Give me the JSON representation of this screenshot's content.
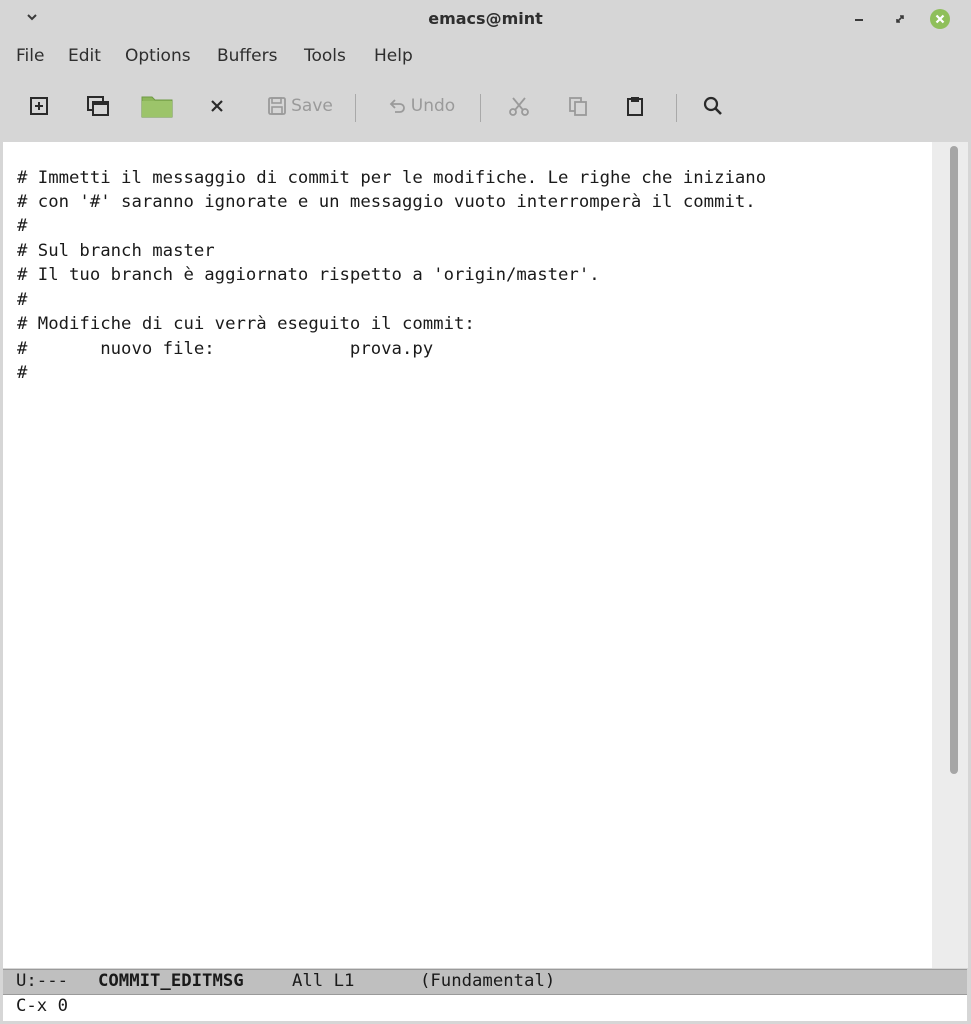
{
  "window": {
    "title": "emacs@mint"
  },
  "menubar": {
    "items": [
      "File",
      "Edit",
      "Options",
      "Buffers",
      "Tools",
      "Help"
    ]
  },
  "toolbar": {
    "save_label": "Save",
    "undo_label": "Undo",
    "icons": [
      "new-file-icon",
      "new-frame-icon",
      "open-folder-icon",
      "close-icon",
      "save-icon",
      "undo-icon",
      "cut-icon",
      "copy-icon",
      "paste-icon",
      "search-icon"
    ]
  },
  "buffer": {
    "lines": [
      "# Immetti il messaggio di commit per le modifiche. Le righe che iniziano",
      "# con '#' saranno ignorate e un messaggio vuoto interromperà il commit.",
      "#",
      "# Sul branch master",
      "# Il tuo branch è aggiornato rispetto a 'origin/master'.",
      "#",
      "# Modifiche di cui verrà eseguito il commit:",
      "#       nuovo file:             prova.py",
      "#"
    ]
  },
  "modeline": {
    "status": "U:---",
    "buffer_name": "COMMIT_EDITMSG",
    "position": "All L1",
    "mode": "(Fundamental)"
  },
  "minibuffer": {
    "text": "C-x 0"
  },
  "colors": {
    "chrome": "#d6d6d6",
    "editor_bg": "#ffffff",
    "modeline_bg": "#bfbfbf",
    "folder_green": "#8cb65a",
    "close_button": "#8fbf5a"
  }
}
